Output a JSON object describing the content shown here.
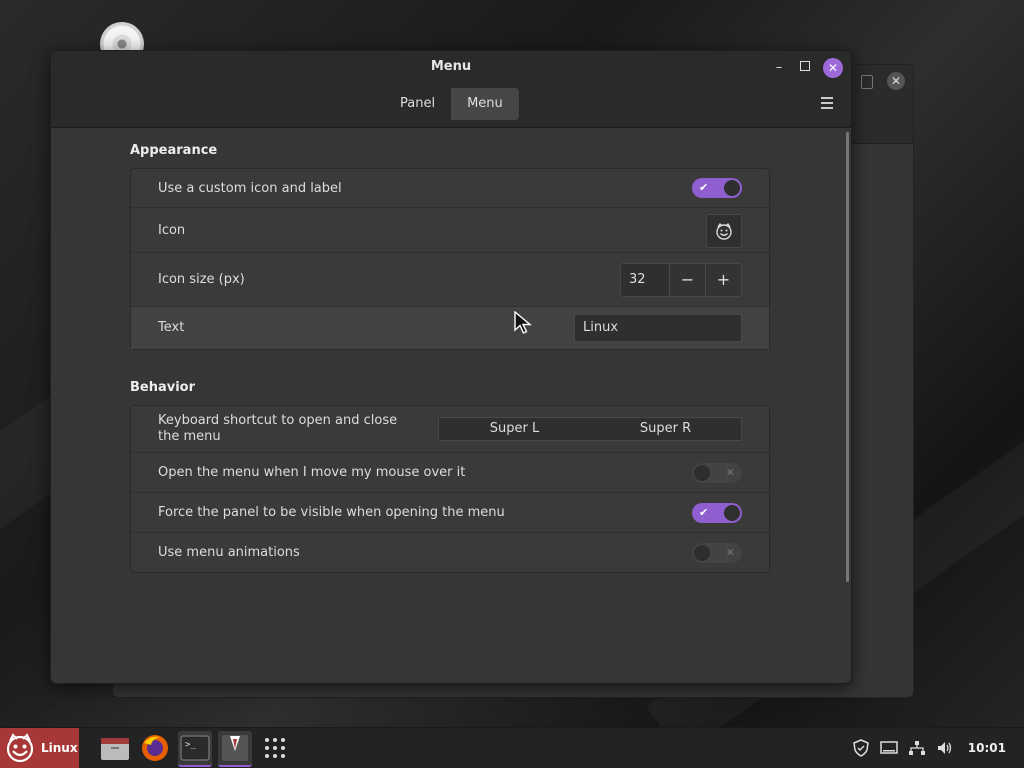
{
  "window": {
    "title": "Menu"
  },
  "tabs": [
    {
      "label": "Panel"
    },
    {
      "label": "Menu"
    }
  ],
  "appearance": {
    "title": "Appearance",
    "custom_icon_label": "Use a custom icon and label",
    "custom_icon_on": true,
    "icon_label": "Icon",
    "icon_size_label": "Icon size (px)",
    "icon_size_value": "32",
    "text_label": "Text",
    "text_value": "Linux"
  },
  "behavior": {
    "title": "Behavior",
    "shortcut_label": "Keyboard shortcut to open and close the menu",
    "shortcut_keys": [
      "Super L",
      "Super R"
    ],
    "hover_open_label": "Open the menu when I move my mouse over it",
    "hover_open_on": false,
    "force_panel_label": "Force the panel to be visible when opening the menu",
    "force_panel_on": true,
    "animations_label": "Use menu animations",
    "animations_on": false
  },
  "taskbar": {
    "menu_label": "Linux",
    "clock": "10:01",
    "apps": [
      "file-manager-icon",
      "firefox-icon",
      "terminal-icon",
      "settings-app-icon",
      "app-grid-icon"
    ]
  },
  "colors": {
    "accent": "#8f5fd0",
    "menu_button": "#a83838"
  }
}
